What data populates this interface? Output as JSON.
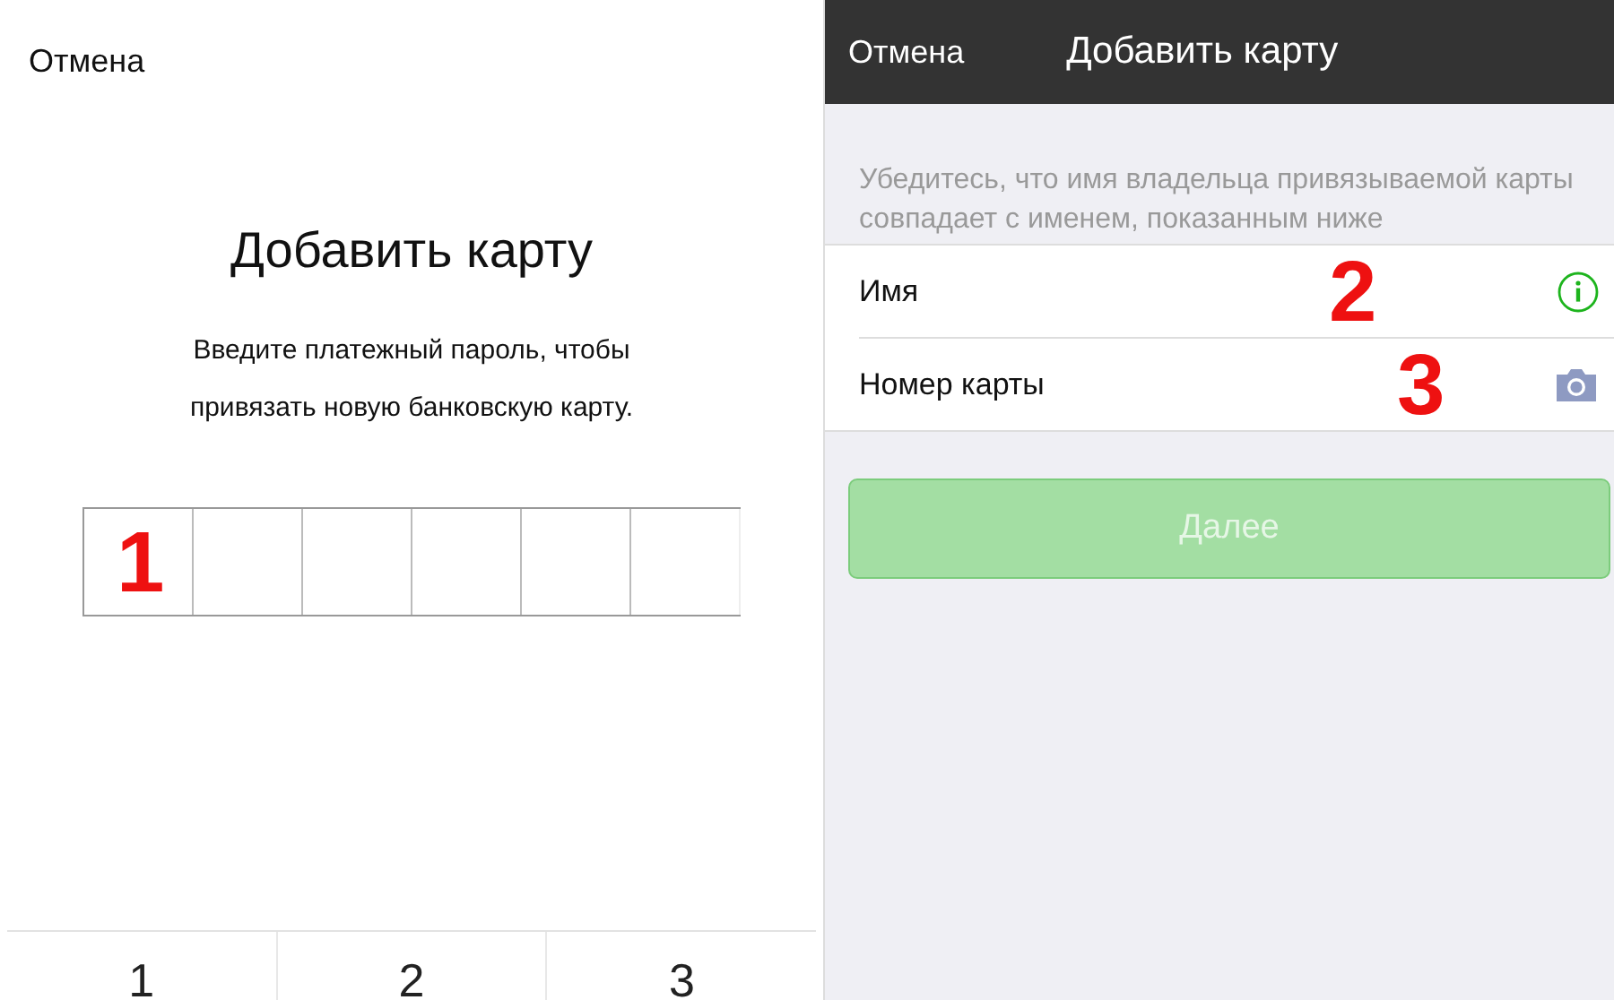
{
  "left": {
    "cancel": "Отмена",
    "title": "Добавить карту",
    "description": "Введите платежный пароль, чтобы привязать новую банковскую карту.",
    "annotation": "1",
    "keypad": [
      "1",
      "2",
      "3"
    ]
  },
  "right": {
    "header": {
      "cancel": "Отмена",
      "title": "Добавить карту"
    },
    "hint": "Убедитесь, что имя владельца привязываемой карты совпадает с именем, показанным ниже",
    "fields": [
      {
        "label": "Имя",
        "kind": "info",
        "annotation": "2"
      },
      {
        "label": "Номер карты",
        "kind": "camera",
        "annotation": "3"
      }
    ],
    "next_button": {
      "label": "Далее",
      "disabled": true
    }
  }
}
